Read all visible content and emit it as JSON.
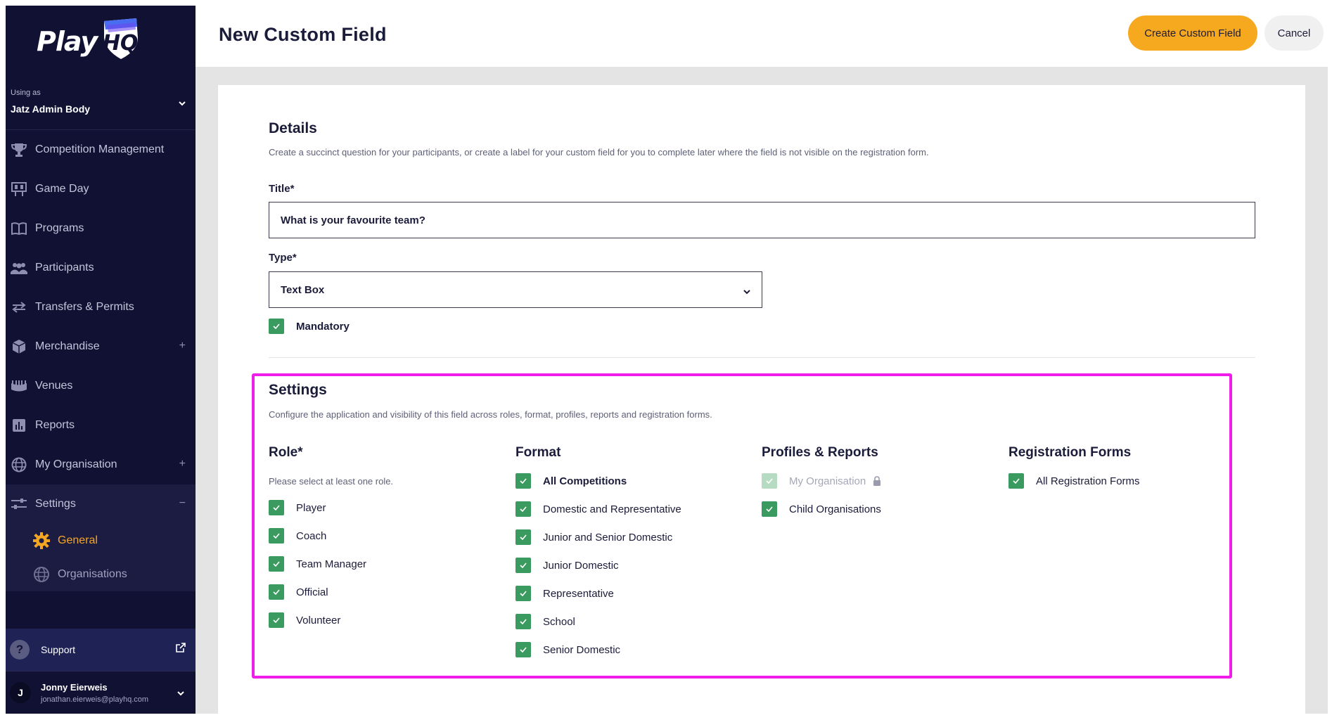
{
  "brand": {
    "logo_text": "Play",
    "logo_mark": "HQ",
    "accent": "#f6a81f",
    "sidebar_bg": "#111133",
    "check_color": "#3b9a5f",
    "highlight": "#f01ee8"
  },
  "org": {
    "using_as_label": "Using as",
    "name": "Jatz Admin Body"
  },
  "nav": [
    {
      "label": "Competition Management",
      "icon": "trophy-icon"
    },
    {
      "label": "Game Day",
      "icon": "scoreboard-icon"
    },
    {
      "label": "Programs",
      "icon": "book-icon"
    },
    {
      "label": "Participants",
      "icon": "people-icon"
    },
    {
      "label": "Transfers & Permits",
      "icon": "transfer-icon"
    },
    {
      "label": "Merchandise",
      "icon": "box-icon",
      "expand": "+"
    },
    {
      "label": "Venues",
      "icon": "stadium-icon"
    },
    {
      "label": "Reports",
      "icon": "chart-icon"
    },
    {
      "label": "My Organisation",
      "icon": "globe-icon",
      "expand": "+"
    },
    {
      "label": "Settings",
      "icon": "sliders-icon",
      "expand": "−"
    }
  ],
  "settings_sub": [
    {
      "label": "General",
      "icon": "gear-icon"
    },
    {
      "label": "Organisations",
      "icon": "globe-icon"
    }
  ],
  "support": {
    "label": "Support"
  },
  "user": {
    "initial": "J",
    "name": "Jonny Eierweis",
    "email": "jonathan.eierweis@playhq.com"
  },
  "header": {
    "title": "New Custom Field",
    "create_label": "Create Custom Field",
    "cancel_label": "Cancel"
  },
  "details": {
    "title": "Details",
    "description": "Create a succinct question for your participants, or create a label for your custom field for you to complete later where the field is not visible on the registration form.",
    "title_label": "Title*",
    "title_value": "What is your favourite team?",
    "type_label": "Type*",
    "type_value": "Text Box",
    "mandatory_label": "Mandatory"
  },
  "settings": {
    "title": "Settings",
    "description": "Configure the application and visibility of this field across roles, format, profiles, reports and registration forms.",
    "role": {
      "title": "Role*",
      "hint": "Please select at least one role.",
      "items": [
        "Player",
        "Coach",
        "Team Manager",
        "Official",
        "Volunteer"
      ]
    },
    "format": {
      "title": "Format",
      "items": [
        "All Competitions",
        "Domestic and Representative",
        "Junior and Senior Domestic",
        "Junior Domestic",
        "Representative",
        "School",
        "Senior Domestic"
      ]
    },
    "profiles": {
      "title": "Profiles & Reports",
      "items": [
        "My Organisation",
        "Child Organisations"
      ]
    },
    "registration": {
      "title": "Registration Forms",
      "items": [
        "All Registration Forms"
      ]
    }
  }
}
